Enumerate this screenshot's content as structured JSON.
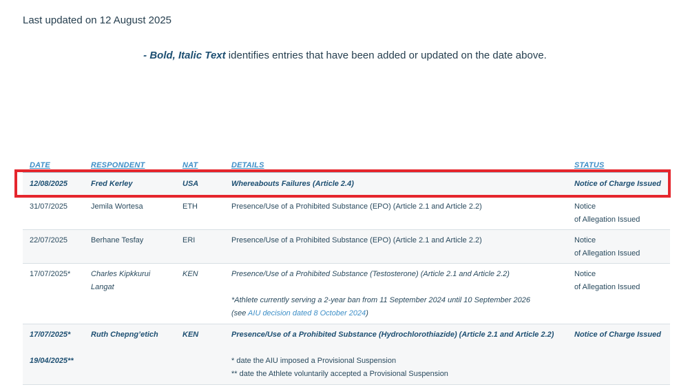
{
  "page": {
    "last_updated": "Last updated on 12 August 2025",
    "legend_bold": "- Bold, Italic Text",
    "legend_rest": " identifies entries that have been added or updated on the date above."
  },
  "table": {
    "headers": {
      "date": "DATE",
      "respondent": "RESPONDENT",
      "nat": "NAT",
      "details": "DETAILS",
      "status": "STATUS"
    },
    "rows": [
      {
        "date": "12/08/2025",
        "respondent": "Fred Kerley",
        "nat": "USA",
        "details": "Whereabouts Failures (Article 2.4)",
        "status": "Notice of Charge Issued"
      },
      {
        "date": "31/07/2025",
        "respondent": "Jemila Wortesa",
        "nat": "ETH",
        "details": "Presence/Use of a Prohibited Substance (EPO) (Article 2.1 and Article 2.2)",
        "status_line1": "Notice",
        "status_line2": "of Allegation Issued"
      },
      {
        "date": "22/07/2025",
        "respondent": "Berhane Tesfay",
        "nat": "ERI",
        "details": "Presence/Use of a Prohibited Substance (EPO) (Article 2.1 and Article 2.2)",
        "status_line1": "Notice",
        "status_line2": "of Allegation Issued"
      },
      {
        "date": "17/07/2025*",
        "respondent_line1": "Charles Kipkkurui",
        "respondent_line2": "Langat",
        "nat": "KEN",
        "details": "Presence/Use of a Prohibited Substance (Testosterone) (Article 2.1 and Article 2.2)",
        "note_line1": "*Athlete currently serving a 2-year ban from 11 September 2024 until 10 September 2026",
        "note_line2_pre": "(see ",
        "note_link": "AIU decision dated 8 October 2024",
        "note_line2_post": ")",
        "status_line1": "Notice",
        "status_line2": "of Allegation Issued"
      },
      {
        "date_line1": "17/07/2025*",
        "date_line2": "19/04/2025**",
        "respondent": "Ruth Chepng’etich",
        "nat": "KEN",
        "details": "Presence/Use of a Prohibited Substance (Hydrochlorothiazide) (Article 2.1 and Article 2.2)",
        "note_line1": "* date the AIU imposed a Provisional Suspension",
        "note_line2": "** date the Athlete voluntarily accepted a Provisional Suspension",
        "status": "Notice of Charge Issued"
      }
    ]
  },
  "highlight": {
    "color": "#e5262d"
  }
}
